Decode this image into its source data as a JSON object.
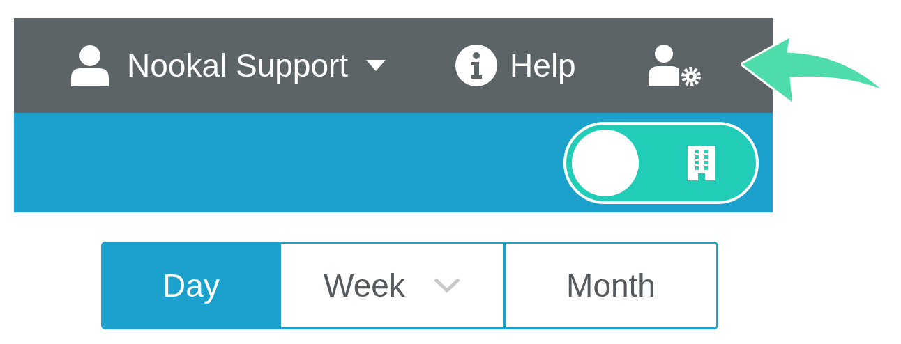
{
  "top_bar": {
    "user": "Nookal Support",
    "help": "Help"
  },
  "location_toggle": {
    "on": false
  },
  "view_tabs": [
    {
      "label": "Day",
      "selected": true,
      "kind": "plain"
    },
    {
      "label": "Week",
      "selected": false,
      "kind": "dropdown"
    },
    {
      "label": "Month",
      "selected": false,
      "kind": "plain"
    }
  ]
}
